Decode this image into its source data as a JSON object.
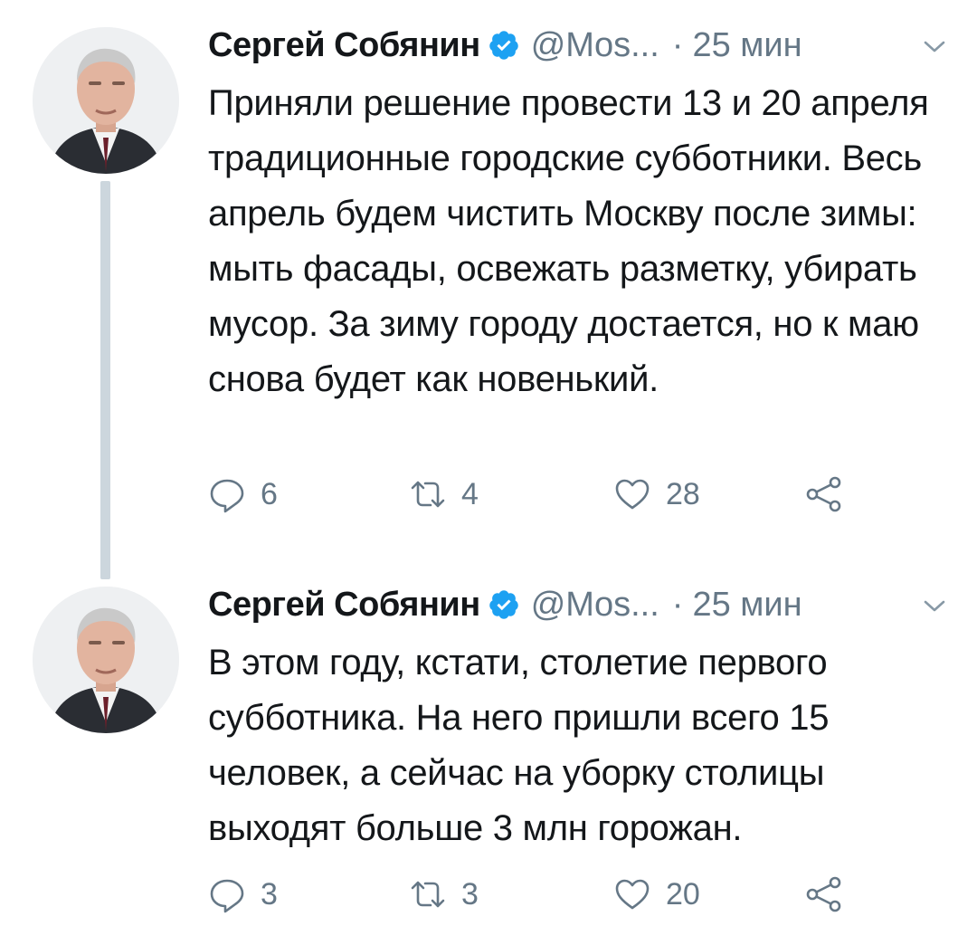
{
  "tweets": [
    {
      "author": {
        "name": "Сергей Собянин",
        "handle": "@Mos...",
        "verified": true
      },
      "separator": "·",
      "time": "25 мин",
      "text": "Приняли решение провести 13 и 20 апреля традиционные городские субботники. Весь апрель будем чистить Москву после зимы: мыть фасады, освежать разметку, убирать мусор. За зиму городу достается, но к маю снова будет как новенький.",
      "actions": {
        "reply_icon": "reply-icon",
        "reply_count": "6",
        "retweet_icon": "retweet-icon",
        "retweet_count": "4",
        "like_icon": "heart-icon",
        "like_count": "28",
        "share_icon": "share-icon"
      }
    },
    {
      "author": {
        "name": "Сергей Собянин",
        "handle": "@Mos...",
        "verified": true
      },
      "separator": "·",
      "time": "25 мин",
      "text": "В этом году, кстати, столетие первого субботника. На него пришли всего 15 человек, а сейчас на уборку столицы выходят больше 3 млн горожан.",
      "actions": {
        "reply_icon": "reply-icon",
        "reply_count": "3",
        "retweet_icon": "retweet-icon",
        "retweet_count": "3",
        "like_icon": "heart-icon",
        "like_count": "20",
        "share_icon": "share-icon"
      }
    }
  ],
  "colors": {
    "text": "#14171a",
    "secondary": "#657786",
    "verified": "#1da1f2",
    "thread_line": "#ccd6dd"
  }
}
